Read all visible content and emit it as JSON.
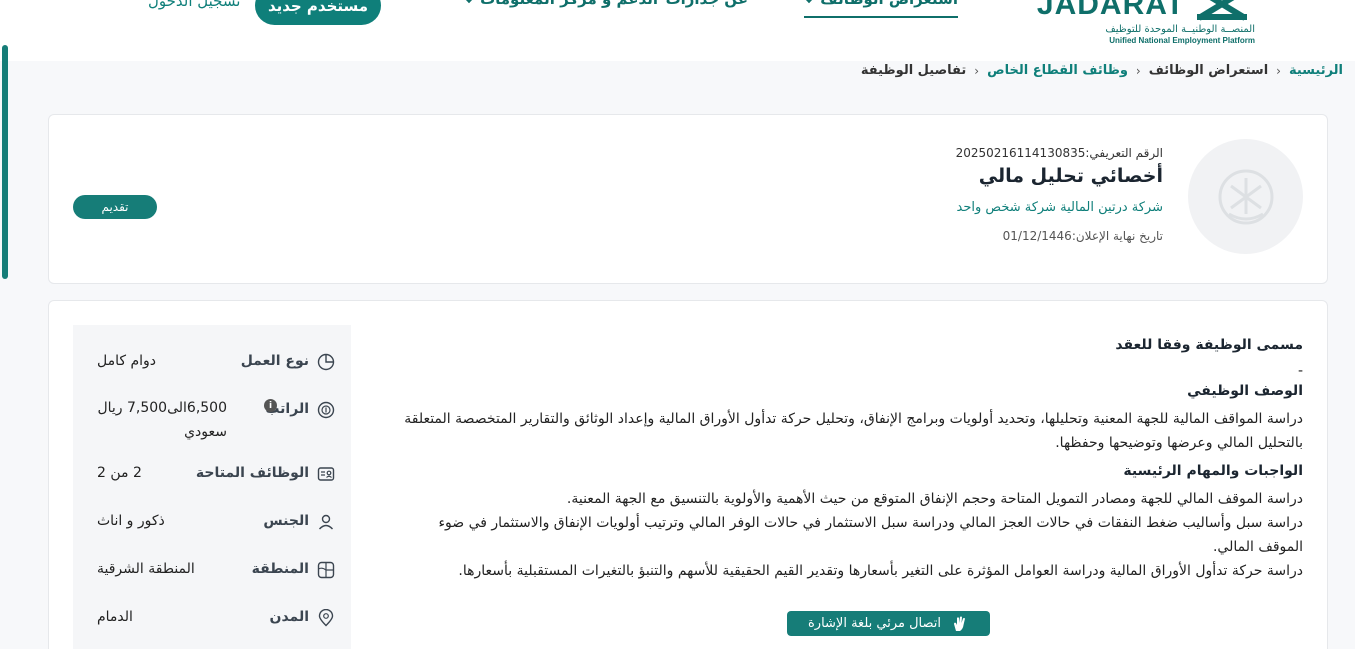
{
  "header": {
    "logo": {
      "word": "JADARAT",
      "ar": "المنصــة الوطنيــة الموحدة للتوظيف",
      "en": "Unified National Employment Platform"
    },
    "nav": [
      {
        "label": "استعراض الوظائف"
      },
      {
        "label": "عن جدارات"
      },
      {
        "label": "الدعم و مركز المعلومات"
      }
    ],
    "register_label": "مستخدم جديد",
    "login_label": "تسجيل الدخول"
  },
  "breadcrumb": {
    "home": "الرئيسية",
    "jobs": "استعراض الوظائف",
    "private": "وظائف القطاع الخاص",
    "current": "تفاصيل الوظيفة"
  },
  "job": {
    "ref": "الرقم التعريفي:20250216114130835",
    "title": "أخصائي تحليل مالي",
    "company": "شركة درتين المالية شركة شخص واحد",
    "deadline": "تاريخ نهاية الإعلان:01/12/1446",
    "apply_label": "تقديم"
  },
  "description": {
    "contract_title_heading": "مسمى الوظيفة وفقا للعقد",
    "contract_title_value": "-",
    "desc_heading": "الوصف الوظيفي",
    "desc_text": "دراسة المواقف المالية للجهة المعنية وتحليلها، وتحديد أولويات وبرامج الإنفاق، وتحليل حركة تدأول الأوراق المالية وإعداد الوثائق والتقارير المتخصصة المتعلقة بالتحليل المالي وعرضها وتوضيحها وحفظها.",
    "duties_heading": "الواجبات والمهام الرئيسية",
    "duties": [
      " دراسة الموقف المالي للجهة ومصادر التمويل المتاحة وحجم الإنفاق المتوقع من حيث الأهمية والأولوية بالتنسيق مع الجهة المعنية.",
      " دراسة سبل وأساليب ضغط النفقات في حالات العجز المالي ودراسة سبل الاستثمار في حالات الوفر المالي وترتيب أولويات الإنفاق والاستثمار في ضوء الموقف المالي.",
      " دراسة حركة تدأول الأوراق المالية ودراسة العوامل المؤثرة على التغير بأسعارها وتقدير القيم الحقيقية للأسهم والتنبؤ بالتغيرات المستقبلية بأسعارها."
    ]
  },
  "sidebar": [
    {
      "label": "نوع العمل",
      "value": "دوام كامل",
      "icon": "pie-icon"
    },
    {
      "label": "الراتب",
      "value": "6,500الى7,500 ريال سعودي",
      "icon": "money-icon"
    },
    {
      "label": "الوظائف المتاحة",
      "value": "2 من 2",
      "icon": "id-card-icon"
    },
    {
      "label": "الجنس",
      "value": "ذكور و اناث",
      "icon": "user-icon"
    },
    {
      "label": "المنطقة",
      "value": "المنطقة الشرقية",
      "icon": "map-icon"
    },
    {
      "label": "المدن",
      "value": "الدمام",
      "icon": "pin-icon"
    }
  ],
  "sign_language": {
    "label": "اتصال مرئي بلغة الإشارة"
  },
  "colors": {
    "brand": "#0f7f7a",
    "background": "#f7f8fa"
  }
}
